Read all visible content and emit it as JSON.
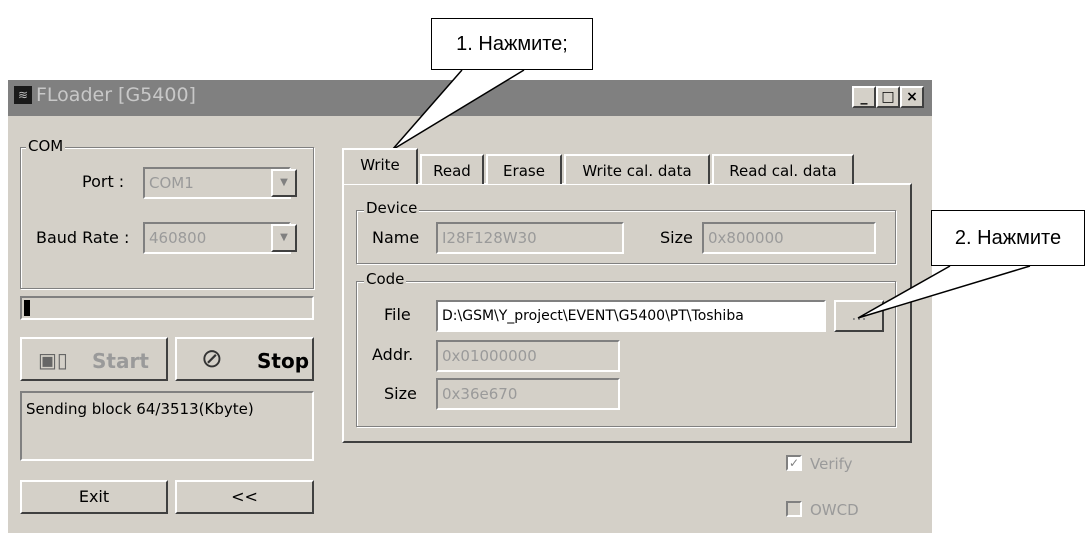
{
  "window": {
    "title": "FLoader [G5400]",
    "controls": {
      "minimize": "_",
      "maximize": "□",
      "close": "×"
    }
  },
  "com": {
    "legend": "COM",
    "port_label": "Port :",
    "port_value": "COM1",
    "baud_label": "Baud Rate :",
    "baud_value": "460800"
  },
  "progress": {
    "value": 0.02
  },
  "buttons": {
    "start": "Start",
    "stop": "Stop",
    "exit": "Exit",
    "collapse": "<<",
    "browse": "..."
  },
  "status_text": "Sending block 64/3513(Kbyte)",
  "tabs": [
    "Write",
    "Read",
    "Erase",
    "Write cal. data",
    "Read cal. data"
  ],
  "device": {
    "legend": "Device",
    "name_label": "Name",
    "name_value": "I28F128W30",
    "size_label": "Size",
    "size_value": "0x800000"
  },
  "code": {
    "legend": "Code",
    "file_label": "File",
    "file_value": "D:\\GSM\\Y_project\\EVENT\\G5400\\PT\\Toshiba",
    "addr_label": "Addr.",
    "addr_value": "0x01000000",
    "size_label": "Size",
    "size_value": "0x36e670"
  },
  "options": {
    "verify": "Verify",
    "owcd": "OWCD"
  },
  "callouts": {
    "first": "1. Нажмите;",
    "second": "2. Нажмите"
  },
  "icons": [
    "app-icon",
    "computer-phone-icon",
    "stop-circle-icon",
    "combo-arrow-icon",
    "checkmark-icon"
  ]
}
